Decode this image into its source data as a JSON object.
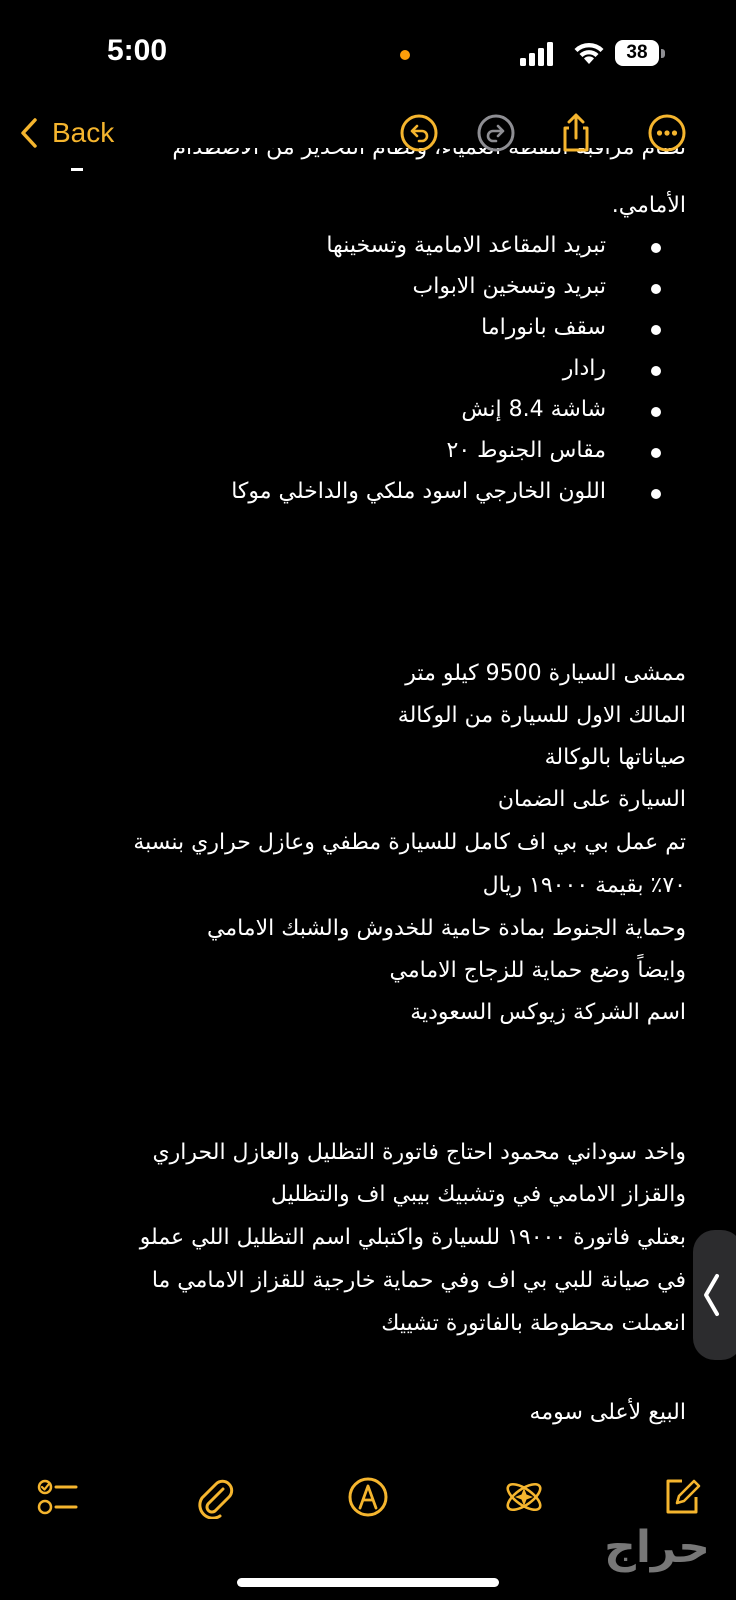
{
  "status_bar": {
    "time": "5:00",
    "battery": "38"
  },
  "nav": {
    "back_label": "Back"
  },
  "note": {
    "clipped_top_line": "نظام مراقبة النقطة العمياء، ونظام التحذير من الاصطدام",
    "continuation_line": "الأمامي.",
    "bullets": [
      "تبريد المقاعد الامامية وتسخينها",
      "تبريد وتسخين الابواب",
      "سقف بانوراما",
      "رادار",
      "شاشة 8.4 إنش",
      "مقاس الجنوط ٢٠",
      "اللون الخارجي اسود ملكي والداخلي موكا"
    ],
    "paragraph1": [
      "ممشى السيارة 9500 كيلو متر",
      "المالك الاول للسيارة من الوكالة",
      "صياناتها بالوكالة",
      "السيارة على الضمان",
      "تم عمل بي بي اف كامل للسيارة مطفي وعازل حراري بنسبة",
      "٧٠٪  بقيمة ١٩٠٠٠ ريال",
      "وحماية الجنوط بمادة حامية للخدوش والشبك الامامي",
      "وايضاً وضع حماية للزجاج الامامي",
      "اسم الشركة زيوكس السعودية"
    ],
    "paragraph2": [
      "واخد سوداني محمود احتاج فاتورة التظليل والعازل الحراري",
      "والقزاز الامامي في وتشبيك بيبي اف والتظليل",
      "بعتلي فاتورة ١٩٠٠٠ للسيارة واكتبلي اسم التظليل اللي عملو",
      "في صيانة للبي بي اف وفي حماية خارجية للقزاز الامامي ما",
      "انعملت محطوطة بالفاتورة تشييك"
    ],
    "closing": "البيع لأعلى سومه"
  },
  "watermark": {
    "text": "حراج"
  },
  "colors": {
    "accent": "#f5b52e",
    "background": "#000000",
    "text": "#ffffff",
    "disabled": "#8e8e93"
  },
  "icons": {
    "back": "chevron-left-icon",
    "undo": "undo-icon",
    "redo": "redo-icon",
    "share": "share-icon",
    "more": "more-icon",
    "checklist": "checklist-icon",
    "attachment": "paperclip-icon",
    "markup": "pen-tip-icon",
    "ai": "sparkle-atom-icon",
    "compose": "compose-icon",
    "side_tab": "chevron-left-icon"
  }
}
